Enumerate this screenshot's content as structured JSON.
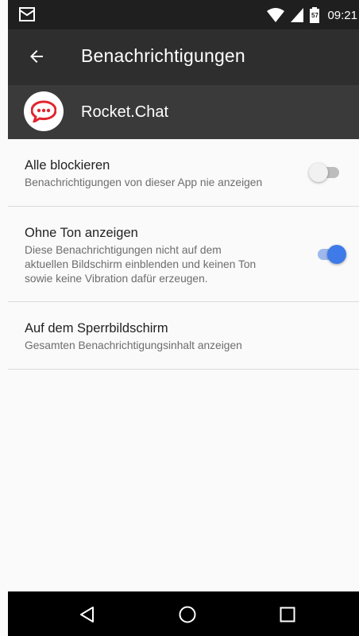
{
  "status_bar": {
    "time": "09:21",
    "battery_level": "57",
    "icons": [
      "mail-icon",
      "wifi-icon",
      "signal-icon",
      "battery-icon"
    ]
  },
  "app_bar": {
    "title": "Benachrichtigungen",
    "back_icon": "arrow-back-icon"
  },
  "app_header": {
    "name": "Rocket.Chat",
    "logo_icon": "rocket-chat-logo-icon",
    "logo_color": "#e0262f"
  },
  "settings": [
    {
      "label": "Alle blockieren",
      "description": "Benachrichtigungen von dieser App nie anzeigen",
      "enabled": false
    },
    {
      "label": "Ohne Ton anzeigen",
      "description_lines": [
        "Diese Benachrichtigungen nicht auf dem",
        "aktuellen Bildschirm einblenden und keinen Ton",
        "sowie keine Vibration dafür erzeugen."
      ],
      "enabled": true
    },
    {
      "label": "Auf dem Sperrbildschirm",
      "description": "Gesamten Benachrichtigungsinhalt anzeigen"
    }
  ],
  "colors": {
    "accent": "#3f7be8",
    "status_bar": "#1f1f1f",
    "app_bar": "#2e2e2e",
    "app_header": "#3a3a3a"
  },
  "nav_bar": {
    "icons": [
      "back-triangle-icon",
      "home-circle-icon",
      "recents-square-icon"
    ]
  }
}
